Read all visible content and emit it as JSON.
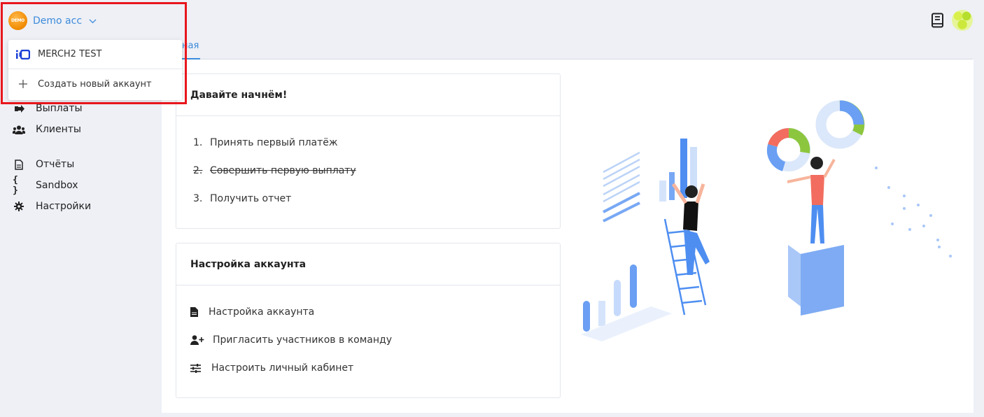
{
  "account": {
    "logo_text": "DEMO",
    "name": "Demo acc"
  },
  "tabs": [
    {
      "label": "ная",
      "active": true
    }
  ],
  "dropdown": {
    "items": [
      {
        "label": "MERCH2 TEST",
        "icon": "merch-logo-icon"
      },
      {
        "label": "Создать новый аккаунт",
        "icon": "plus-icon"
      }
    ]
  },
  "sidebar": {
    "items": [
      {
        "label": "Выплаты",
        "icon": "sign-out-icon"
      },
      {
        "label": "Клиенты",
        "icon": "users-icon"
      },
      {
        "label": "Отчёты",
        "icon": "file-icon"
      },
      {
        "label": "Sandbox",
        "icon": "braces-icon"
      },
      {
        "label": "Настройки",
        "icon": "gear-icon"
      }
    ]
  },
  "start_card": {
    "title": "Давайте начнём!",
    "steps": [
      {
        "num": "1.",
        "label": "Принять первый платёж",
        "done": false
      },
      {
        "num": "2.",
        "label": "Совершить первую выплату",
        "done": true
      },
      {
        "num": "3.",
        "label": "Получить отчет",
        "done": false
      }
    ]
  },
  "setup_card": {
    "title": "Настройка аккаунта",
    "links": [
      {
        "label": "Настройка аккаунта",
        "icon": "file-icon"
      },
      {
        "label": "Пригласить участников в команду",
        "icon": "user-plus-icon"
      },
      {
        "label": "Настроить личный кабинет",
        "icon": "sliders-icon"
      }
    ]
  },
  "header_icons": [
    "book-icon",
    "avatar"
  ],
  "colors": {
    "accent": "#3d8bd9",
    "highlight": "#e8161d",
    "background": "#eef0f6"
  }
}
